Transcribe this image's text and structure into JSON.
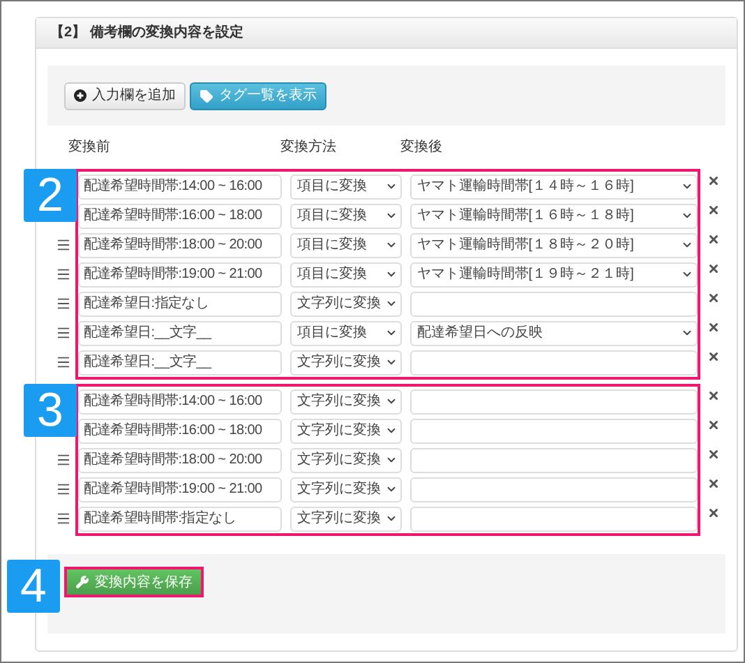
{
  "panel": {
    "title": "【2】 備考欄の変換内容を設定"
  },
  "toolbar": {
    "buttons": [
      {
        "label": "入力欄を追加",
        "kind": "add"
      },
      {
        "label": "タグ一覧を表示",
        "kind": "tags"
      }
    ]
  },
  "columns": [
    "変換前",
    "変換方法",
    "変換後"
  ],
  "groups": [
    {
      "badge": "2",
      "rows": [
        {
          "before": "配達希望時間帯:14:00 ~ 16:00",
          "method": "項目に変換",
          "after": "ヤマト運輸時間帯[１４時～１６時]",
          "kind": "select",
          "handle": false
        },
        {
          "before": "配達希望時間帯:16:00 ~ 18:00",
          "method": "項目に変換",
          "after": "ヤマト運輸時間帯[１６時～１８時]",
          "kind": "select",
          "handle": false
        },
        {
          "before": "配達希望時間帯:18:00 ~ 20:00",
          "method": "項目に変換",
          "after": "ヤマト運輸時間帯[１８時～２０時]",
          "kind": "select",
          "handle": true
        },
        {
          "before": "配達希望時間帯:19:00 ~ 21:00",
          "method": "項目に変換",
          "after": "ヤマト運輸時間帯[１９時～２１時]",
          "kind": "select",
          "handle": true
        },
        {
          "before": "配達希望日:指定なし",
          "method": "文字列に変換",
          "kind": "text",
          "handle": true
        },
        {
          "before": "配達希望日:__文字__",
          "method": "項目に変換",
          "after": "配達希望日への反映",
          "kind": "select",
          "handle": true
        },
        {
          "before": "配達希望日:__文字__",
          "method": "文字列に変換",
          "kind": "text",
          "handle": true
        }
      ]
    },
    {
      "badge": "3",
      "rows": [
        {
          "before": "配達希望時間帯:14:00 ~ 16:00",
          "method": "文字列に変換",
          "kind": "text",
          "handle": false
        },
        {
          "before": "配達希望時間帯:16:00 ~ 18:00",
          "method": "文字列に変換",
          "kind": "text",
          "handle": false
        },
        {
          "before": "配達希望時間帯:18:00 ~ 20:00",
          "method": "文字列に変換",
          "kind": "text",
          "handle": true
        },
        {
          "before": "配達希望時間帯:19:00 ~ 21:00",
          "method": "文字列に変換",
          "kind": "text",
          "handle": true
        },
        {
          "before": "配達希望時間帯:指定なし",
          "method": "文字列に変換",
          "kind": "text",
          "handle": true
        }
      ]
    }
  ],
  "save": {
    "badge": "4",
    "label": "変換内容を保存"
  }
}
